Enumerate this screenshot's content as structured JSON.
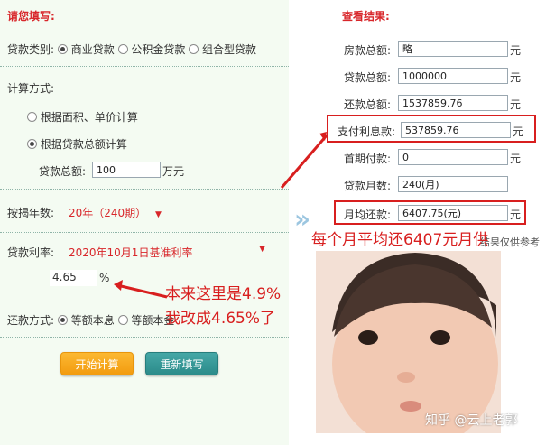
{
  "left": {
    "title": "请您填写:",
    "loan_type_label": "贷款类别:",
    "loan_types": [
      "商业贷款",
      "公积金贷款",
      "组合型贷款"
    ],
    "calc_method_label": "计算方式:",
    "calc_by_area": "根据面积、单价计算",
    "calc_by_total": "根据贷款总额计算",
    "loan_total_label": "贷款总额:",
    "loan_total_value": "100",
    "loan_total_unit": "万元",
    "years_label": "按揭年数:",
    "years_value": "20年（240期）",
    "rate_label": "贷款利率:",
    "rate_value": "2020年10月1日基准利率",
    "rate_input": "4.65",
    "rate_unit": "%",
    "repay_label": "还款方式:",
    "repay_options": [
      "等额本息",
      "等额本金"
    ],
    "calc_button": "开始计算",
    "reset_button": "重新填写"
  },
  "right": {
    "title": "查看结果:",
    "rows": [
      {
        "label": "房款总额:",
        "value": "略",
        "unit": "元"
      },
      {
        "label": "贷款总额:",
        "value": "1000000",
        "unit": "元"
      },
      {
        "label": "还款总额:",
        "value": "1537859.76",
        "unit": "元"
      },
      {
        "label": "支付利息款:",
        "value": "537859.76",
        "unit": "元"
      },
      {
        "label": "首期付款:",
        "value": "0",
        "unit": "元"
      },
      {
        "label": "贷款月数:",
        "value": "240(月)",
        "unit": ""
      },
      {
        "label": "月均还款:",
        "value": "6407.75(元)",
        "unit": "元"
      }
    ],
    "footnote": "结果仅供参考"
  },
  "annotations": {
    "monthly": "每个月平均还6407元月供",
    "rate_line1": "本来这里是4.9%",
    "rate_line2": "我改成4.65%了"
  },
  "watermark": "知乎 @云上老郭",
  "colors": {
    "red": "#d81f1f",
    "orange": "#f29b0f",
    "teal": "#2b8b8a",
    "panel": "#f4fbf2"
  }
}
